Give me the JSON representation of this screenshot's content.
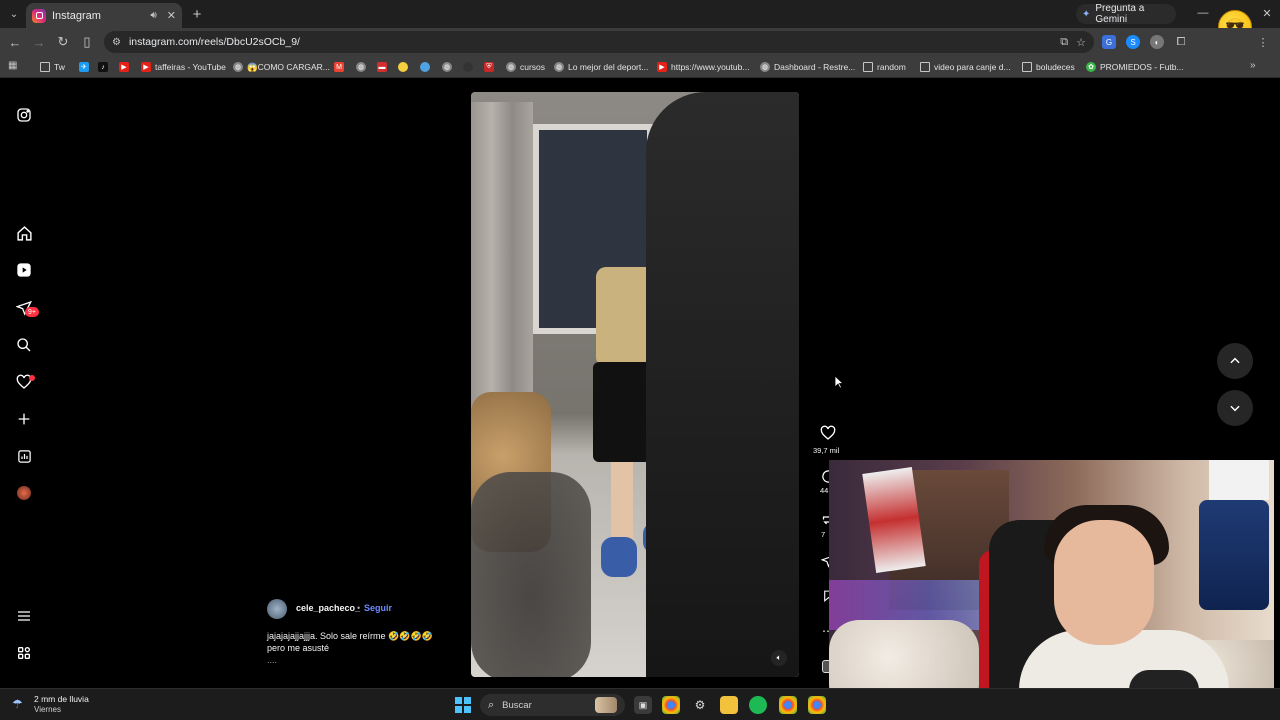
{
  "browser": {
    "tab_title": "Instagram",
    "url": "instagram.com/reels/DbcU2sOCb_9/",
    "gemini_label": "Pregunta a Gemini",
    "bookmarks": [
      {
        "label": "Tw",
        "icon": "folder-icon"
      },
      {
        "label": "",
        "icon": "generic-icon"
      },
      {
        "label": "",
        "icon": "youtube-icon"
      },
      {
        "label": "",
        "icon": "tiktok-icon"
      },
      {
        "label": "taffeiras - YouTube",
        "icon": "youtube-icon"
      },
      {
        "label": "😱COMO CARGAR...",
        "icon": "globe-icon"
      },
      {
        "label": "",
        "icon": "gmail-icon"
      },
      {
        "label": "",
        "icon": "globe-icon"
      },
      {
        "label": "",
        "icon": "red-icon"
      },
      {
        "label": "",
        "icon": "yellow-icon"
      },
      {
        "label": "",
        "icon": "blue-icon"
      },
      {
        "label": "",
        "icon": "globe-icon"
      },
      {
        "label": "",
        "icon": "dark-icon"
      },
      {
        "label": "",
        "icon": "shield-icon"
      },
      {
        "label": "cursos",
        "icon": "globe-icon"
      },
      {
        "label": "Lo mejor del deport...",
        "icon": "globe-icon"
      },
      {
        "label": "https://www.youtub...",
        "icon": "youtube-icon"
      },
      {
        "label": "Dashboard - Restre...",
        "icon": "globe-icon"
      },
      {
        "label": "random",
        "icon": "folder-icon"
      },
      {
        "label": "video para canje d...",
        "icon": "folder-icon"
      },
      {
        "label": "boludeces",
        "icon": "folder-icon"
      },
      {
        "label": "PROMIEDOS - Futb...",
        "icon": "promiedos-icon"
      }
    ]
  },
  "instagram": {
    "messages_badge": "9+",
    "caption": {
      "username": "cele_pacheco_",
      "separator": "•",
      "follow_label": "Seguir",
      "line1": "jajajajajjajjja. Solo sale reírme 🤣🤣🤣🤣",
      "line2": "pero me asusté",
      "more": "...."
    },
    "actions": {
      "like_count": "39,7 mil",
      "comment_count": "44",
      "share_count": "7"
    }
  },
  "taskbar": {
    "weather_text": "2 mm de lluvia",
    "weather_day": "Viernes",
    "search_label": "Buscar"
  },
  "colors": {
    "instagram_bg": "#000000",
    "follow_link": "#6c8cff",
    "notification": "#ff3040",
    "browser_chrome": "#3c3c3c"
  }
}
